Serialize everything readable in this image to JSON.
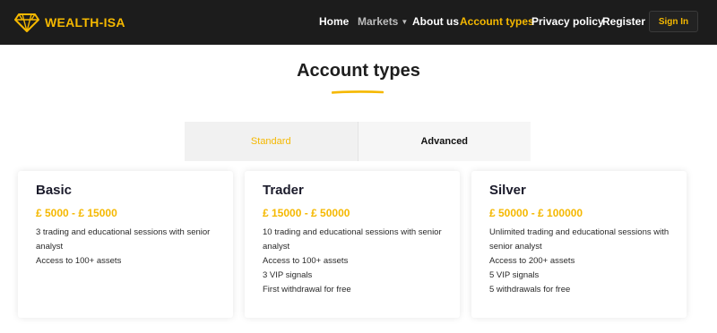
{
  "header": {
    "brand": "WEALTH-ISA",
    "nav": [
      {
        "label": "Home",
        "state": "normal"
      },
      {
        "label": "Markets",
        "state": "dim",
        "dropdown": true
      },
      {
        "label": "About us",
        "state": "normal"
      },
      {
        "label": "Account types",
        "state": "active"
      },
      {
        "label": "Privacy policy",
        "state": "normal"
      },
      {
        "label": "Register",
        "state": "normal"
      }
    ],
    "signin_label": "Sign In"
  },
  "main": {
    "title": "Account types",
    "tabs": [
      {
        "label": "Standard",
        "active": true
      },
      {
        "label": "Advanced",
        "active": false
      }
    ],
    "cards": [
      {
        "name": "Basic",
        "price": "£ 5000 - £ 15000",
        "features": [
          "3 trading and educational sessions with senior analyst",
          "Access to 100+ assets"
        ]
      },
      {
        "name": "Trader",
        "price": "£ 15000 - £ 50000",
        "features": [
          "10 trading and educational sessions with senior analyst",
          "Access to 100+ assets",
          "3 VIP signals",
          "First withdrawal for free"
        ]
      },
      {
        "name": "Silver",
        "price": "£ 50000 - £ 100000",
        "features": [
          "Unlimited trading and educational sessions with senior analyst",
          "Access to 200+ assets",
          "5 VIP signals",
          "5 withdrawals for free"
        ]
      }
    ]
  },
  "colors": {
    "accent": "#f5b800",
    "header_bg": "#1c1c1c"
  },
  "icons": {
    "logo": "diamond-icon",
    "markets_caret": "chevron-down-icon"
  }
}
